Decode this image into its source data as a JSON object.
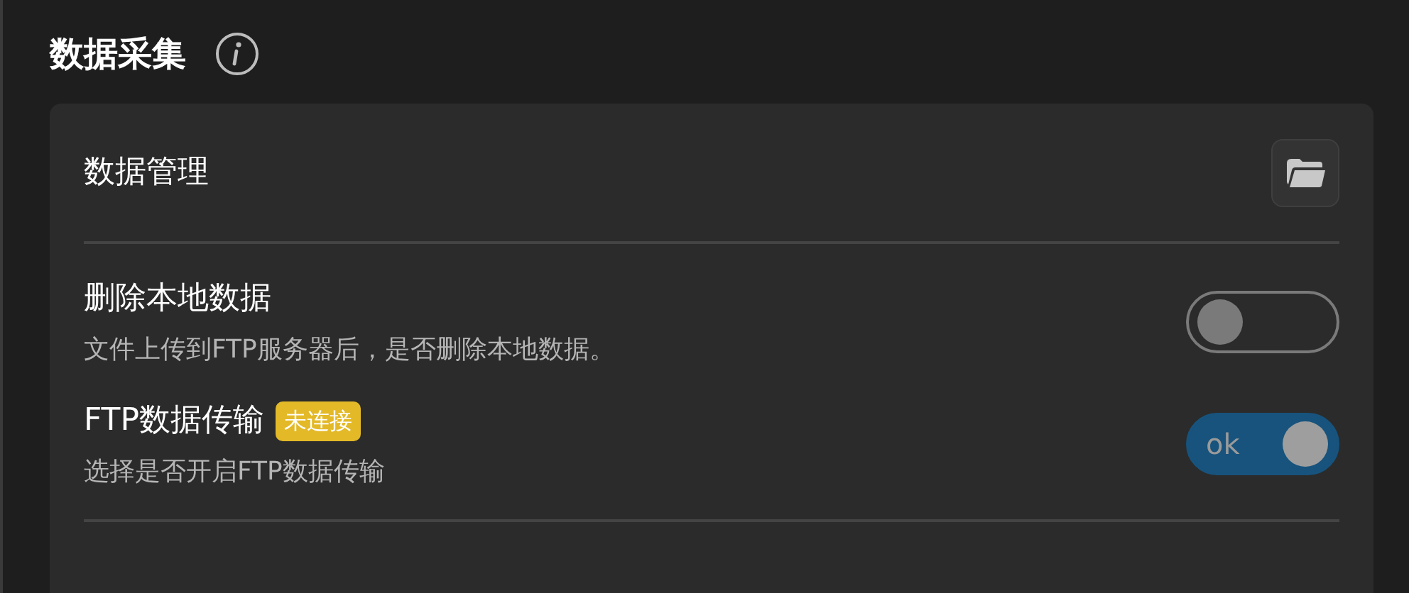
{
  "section": {
    "title": "数据采集"
  },
  "card": {
    "header": {
      "title": "数据管理"
    },
    "settings": [
      {
        "title": "删除本地数据",
        "description": "文件上传到FTP服务器后，是否删除本地数据。",
        "on": false
      },
      {
        "title": "FTP数据传输",
        "badge": {
          "text": "未连接",
          "color": "#e3b928"
        },
        "description": "选择是否开启FTP数据传输",
        "on": true,
        "on_label": "ok"
      }
    ]
  }
}
